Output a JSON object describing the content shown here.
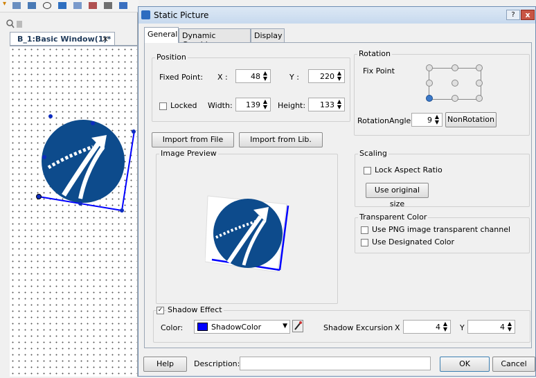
{
  "editor": {
    "doc_tab": "B_1:Basic Window(1)*",
    "close_glyph": "×"
  },
  "dialog": {
    "title": "Static Picture",
    "help_glyph": "?",
    "close_glyph": "x",
    "tabs": [
      {
        "label": "General",
        "active": true
      },
      {
        "label": "Dynamic Graphics",
        "active": false
      },
      {
        "label": "Display",
        "active": false
      }
    ],
    "position": {
      "group_label": "Position",
      "fixed_point_label": "Fixed Point:",
      "x_label": "X :",
      "x_value": "48",
      "y_label": "Y :",
      "y_value": "220",
      "locked_label": "Locked",
      "locked_checked": false,
      "width_label": "Width:",
      "width_value": "139",
      "height_label": "Height:",
      "height_value": "133"
    },
    "rotation": {
      "group_label": "Rotation",
      "fix_point_label": "Fix Point",
      "angle_label": "RotationAngle",
      "angle_value": "9",
      "nonrotation_button": "NonRotation"
    },
    "import_file_button": "Import from File",
    "import_lib_button": "Import from Lib.",
    "image_preview": {
      "group_label": "Image Preview"
    },
    "scaling": {
      "group_label": "Scaling",
      "lock_aspect_label": "Lock Aspect Ratio",
      "lock_aspect_checked": false,
      "original_size_button": "Use original size"
    },
    "transparent": {
      "group_label": "Transparent Color",
      "png_label": "Use PNG image transparent channel",
      "png_checked": false,
      "designated_label": "Use Designated Color",
      "designated_checked": false
    },
    "shadow": {
      "effect_label": "Shadow Effect",
      "effect_checked": true,
      "check_glyph": "✓",
      "color_label": "Color:",
      "color_name": "ShadowColor",
      "color_hex": "#0000ff",
      "excursion_label": "Shadow Excursion",
      "x_label": "X",
      "x_value": "4",
      "y_label": "Y",
      "y_value": "4"
    },
    "footer": {
      "help_button": "Help",
      "description_label": "Description:",
      "description_value": "",
      "ok_button": "OK",
      "cancel_button": "Cancel"
    }
  },
  "colors": {
    "logo_blue": "#0d4b8c",
    "shadow_blue": "#0000ff",
    "accent": "#2d6cc0"
  }
}
